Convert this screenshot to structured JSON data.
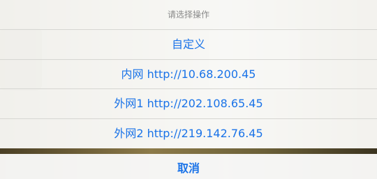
{
  "action_sheet": {
    "title": "请选择操作",
    "options": [
      {
        "label": "自定义"
      },
      {
        "label": "内网 http://10.68.200.45"
      },
      {
        "label": "外网1 http://202.108.65.45"
      },
      {
        "label": "外网2 http://219.142.76.45"
      }
    ],
    "cancel_label": "取消"
  },
  "colors": {
    "accent": "#1a73e8",
    "title_text": "#8a8a8a",
    "separator": "#d6d6d2"
  }
}
